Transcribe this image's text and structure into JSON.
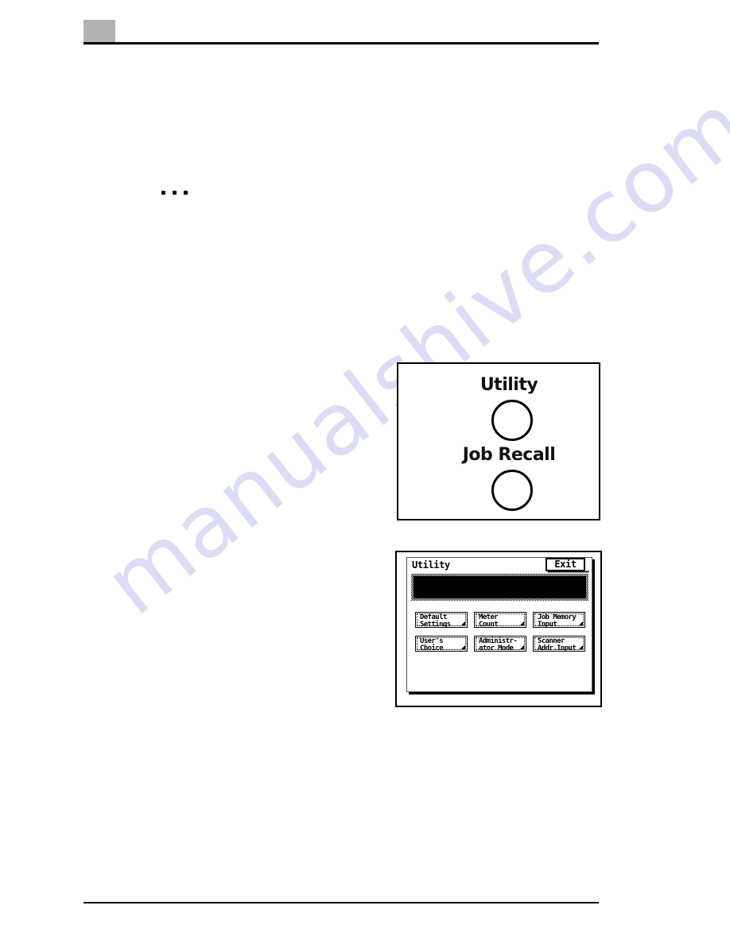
{
  "page": {
    "header_tab_color": "#b3b3b3",
    "rule_color": "#000000",
    "bullet_marker": "•••",
    "watermark_text": "manualshive.com",
    "watermark_color": "#c9c8ef"
  },
  "figure_panel": {
    "caption": "",
    "keys": [
      {
        "label": "Utility",
        "shape": "round-hard-key"
      },
      {
        "label": "Job Recall",
        "shape": "round-hard-key"
      }
    ]
  },
  "figure_lcd": {
    "title": "Utility",
    "exit_label": "Exit",
    "message_area": "",
    "buttons": [
      [
        {
          "label": "Default\nSettings"
        },
        {
          "label": "Meter\nCount"
        },
        {
          "label": "Job Memory\nInput"
        }
      ],
      [
        {
          "label": "User's\nChoice"
        },
        {
          "label": "Administr-\nator Mode"
        },
        {
          "label": "Scanner\nAddr.Input"
        }
      ]
    ]
  }
}
